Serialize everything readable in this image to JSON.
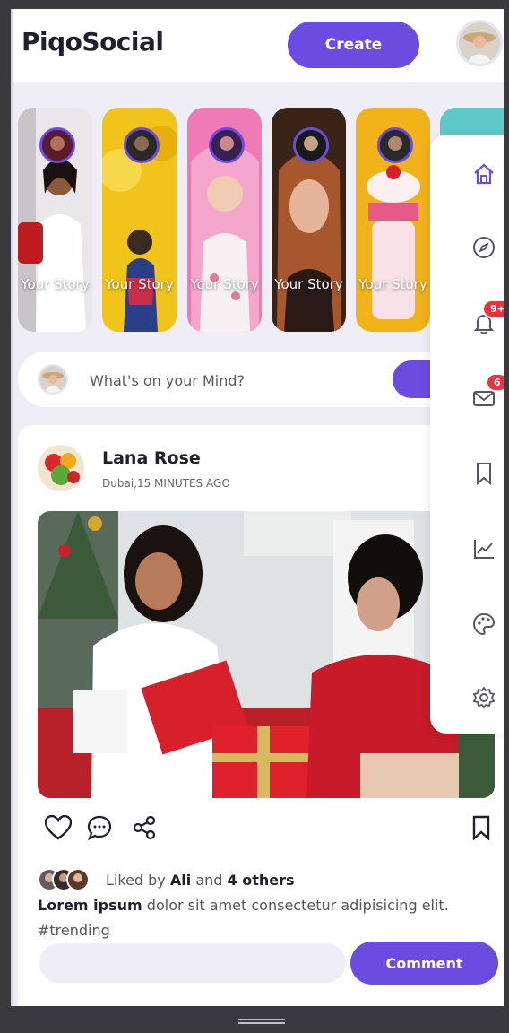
{
  "header": {
    "brand": "PiqoSocial",
    "create_label": "Create"
  },
  "stories": [
    {
      "label": "Your Story",
      "bg": "#e9e7ea"
    },
    {
      "label": "Your Story",
      "bg": "#f0c41a"
    },
    {
      "label": "Your Story",
      "bg": "#f07ab8"
    },
    {
      "label": "Your Story",
      "bg": "#3a2418"
    },
    {
      "label": "Your Story",
      "bg": "#f1b21a"
    }
  ],
  "status": {
    "placeholder": "What's on your Mind?"
  },
  "post": {
    "author": "Lana Rose",
    "meta": "Dubai,15 MINUTES AGO",
    "liked_prefix": "Liked by",
    "liked_name": "Ali",
    "liked_and": "and",
    "liked_others": "4 others",
    "caption_bold": "Lorem ipsum",
    "caption_rest": "dolor sit amet consectetur adipisicing elit.",
    "hashtag": "#trending",
    "comment_label": "Comment"
  },
  "sidenav": {
    "items": [
      "home-icon",
      "explore-icon",
      "notifications-icon",
      "messages-icon",
      "bookmarks-icon",
      "analytics-icon",
      "theme-icon",
      "settings-icon"
    ],
    "notifications_badge": "9+",
    "messages_badge": "6"
  },
  "colors": {
    "accent": "#6b4ce0",
    "badge": "#e8323c"
  }
}
